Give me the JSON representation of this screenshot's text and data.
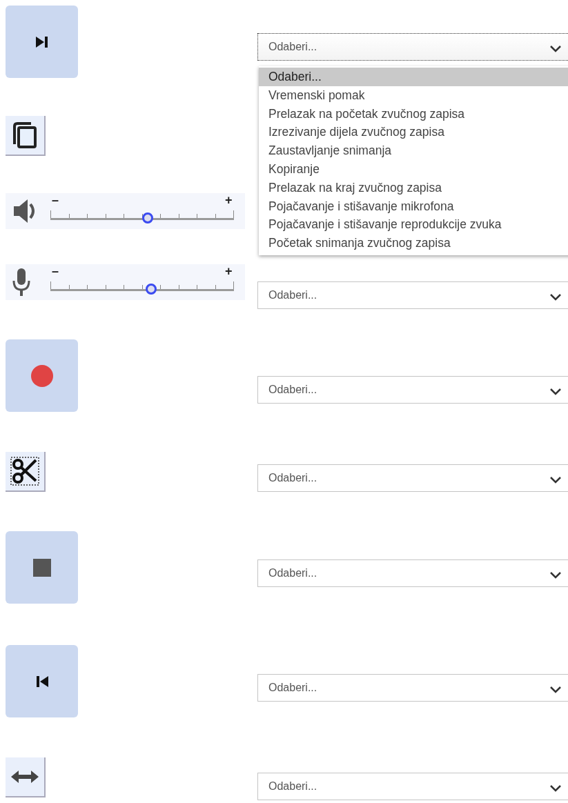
{
  "rows": [
    {
      "kind": "button",
      "select": {
        "value": "Odaberi...",
        "focused": true,
        "expanded": true,
        "options": [
          {
            "label": "Odaberi...",
            "selected": true
          },
          {
            "label": "Vremenski pomak",
            "selected": false
          },
          {
            "label": "Prelazak na početak zvučnog zapisa",
            "selected": false
          },
          {
            "label": "Izrezivanje dijela zvučnog zapisa",
            "selected": false
          },
          {
            "label": "Zaustavljanje snimanja",
            "selected": false
          },
          {
            "label": "Kopiranje",
            "selected": false
          },
          {
            "label": "Prelazak na kraj zvučnog zapisa",
            "selected": false
          },
          {
            "label": "Pojačavanje i stišavanje mikrofona",
            "selected": false
          },
          {
            "label": "Pojačavanje i stišavanje reprodukcije zvuka",
            "selected": false
          },
          {
            "label": "Početak snimanja zvučnog zapisa",
            "selected": false
          }
        ]
      }
    },
    {
      "kind": "tool"
    },
    {
      "kind": "slider",
      "minus": "–",
      "plus": "+",
      "level": 0.53
    },
    {
      "kind": "slider",
      "minus": "–",
      "plus": "+",
      "level": 0.55,
      "select": {
        "value": "Odaberi...",
        "focused": false
      }
    },
    {
      "kind": "button",
      "select": {
        "value": "Odaberi...",
        "focused": false
      }
    },
    {
      "kind": "tool",
      "select": {
        "value": "Odaberi...",
        "focused": false
      }
    },
    {
      "kind": "button",
      "select": {
        "value": "Odaberi...",
        "focused": false
      }
    },
    {
      "kind": "button",
      "select": {
        "value": "Odaberi...",
        "focused": false
      }
    },
    {
      "kind": "tool",
      "select": {
        "value": "Odaberi...",
        "focused": false
      }
    }
  ]
}
